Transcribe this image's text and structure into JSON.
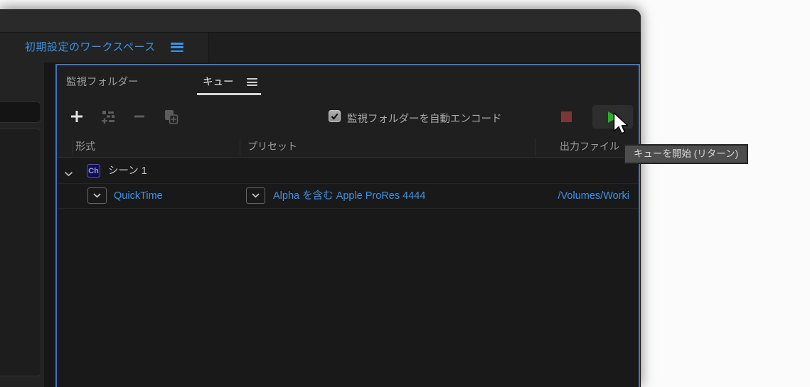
{
  "colors": {
    "accent_blue": "#3A93E8",
    "panel_border_blue": "#3B76C8",
    "play_green": "#2DAC2D",
    "stop_red": "#7D3538",
    "tab_underline": "#D6D6D6",
    "ch_badge_bg": "#10104E",
    "ch_badge_text": "#9B9BF0"
  },
  "workspace_bar": {
    "title": "初期設定のワークスペース",
    "menu_icon": "hamburger-menu-icon"
  },
  "queue_panel": {
    "tabs": [
      {
        "label": "監視フォルダー",
        "active": false
      },
      {
        "label": "キュー",
        "active": true
      }
    ],
    "panel_menu_icon": "hamburger-menu-icon",
    "toolbar": {
      "add_icon": "plus-icon",
      "add_preset_icon": "preset-sliders-icon",
      "remove_icon": "minus-icon",
      "duplicate_icon": "duplicate-icon",
      "auto_encode": {
        "label": "監視フォルダーを自動エンコード",
        "checked": true
      },
      "stop_icon": "stop-square-icon",
      "start_icon": "play-triangle-icon"
    },
    "columns": {
      "format": "形式",
      "preset": "プリセット",
      "output": "出力ファイル"
    },
    "queue_items": [
      {
        "group_label": "シーン 1",
        "app_badge": "Ch",
        "outputs": [
          {
            "format": "QuickTime",
            "preset": "Alpha を含む Apple ProRes 4444",
            "output_file": "/Volumes/Worki"
          }
        ]
      }
    ]
  },
  "tooltip": {
    "text": "キューを開始 (リターン)"
  }
}
